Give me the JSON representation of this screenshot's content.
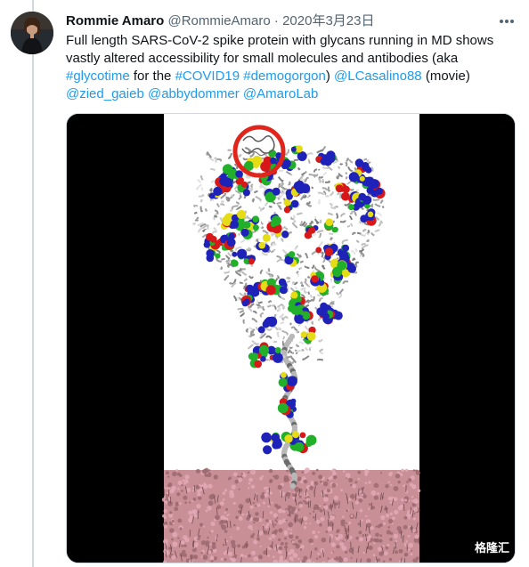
{
  "tweet": {
    "author_name": "Rommie Amaro",
    "handle": "@RommieAmaro",
    "separator": "·",
    "date": "2020年3月23日",
    "more_icon": "more-horizontal-icon",
    "text_parts": [
      {
        "type": "text",
        "value": "Full length SARS-CoV-2 spike protein with glycans running in MD shows vastly altered accessibility for small molecules and antibodies (aka "
      },
      {
        "type": "hashtag",
        "value": "#glycotime"
      },
      {
        "type": "text",
        "value": " for the "
      },
      {
        "type": "hashtag",
        "value": "#COVID19"
      },
      {
        "type": "text",
        "value": " "
      },
      {
        "type": "hashtag",
        "value": "#demogorgon"
      },
      {
        "type": "text",
        "value": ") "
      },
      {
        "type": "mention",
        "value": "@LCasalino88"
      },
      {
        "type": "text",
        "value": " (movie) "
      },
      {
        "type": "mention",
        "value": "@zied_gaieb"
      },
      {
        "type": "text",
        "value": " "
      },
      {
        "type": "mention",
        "value": "@abbydommer"
      },
      {
        "type": "text",
        "value": " "
      },
      {
        "type": "mention",
        "value": "@AmaroLab"
      }
    ],
    "media": {
      "kind": "video-still",
      "subject": "spike protein with glycans on membrane",
      "highlight": "red-circle"
    },
    "watermark": "格隆汇"
  },
  "colors": {
    "link": "#1d9bf0",
    "secondary_text": "#536471",
    "thread_line": "#cfd9de",
    "glycan_blue": "#1f22b8",
    "glycan_green": "#22b02a",
    "glycan_red": "#d81818",
    "glycan_yellow": "#e6dc16",
    "membrane": "#c98f97",
    "highlight_circle": "#e0261c"
  }
}
